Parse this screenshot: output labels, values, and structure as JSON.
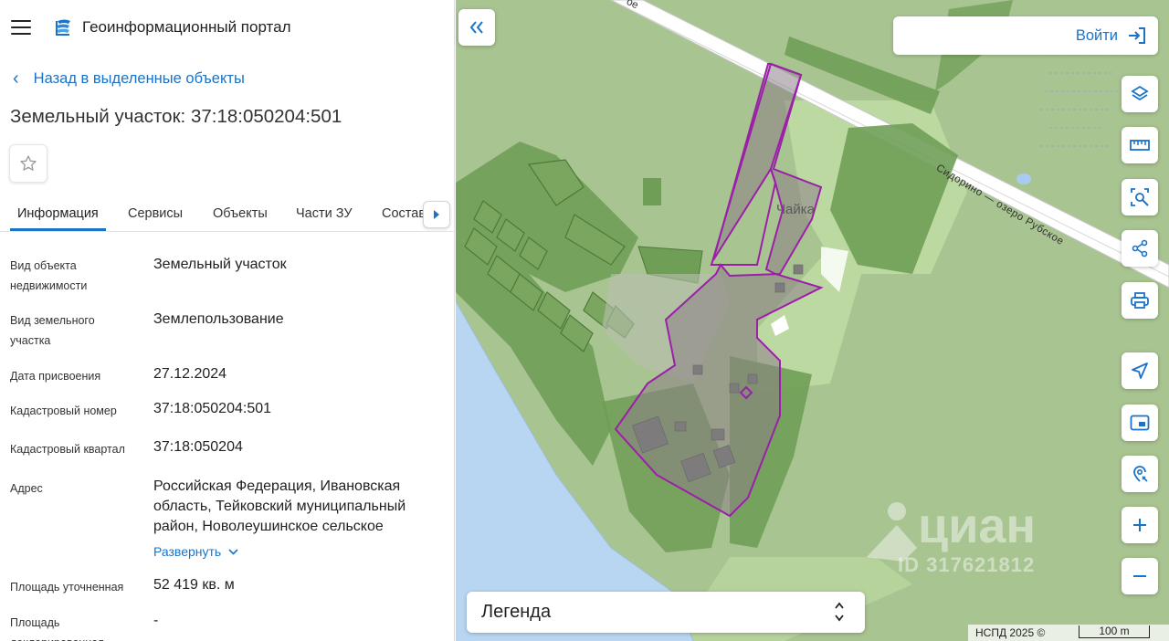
{
  "header": {
    "app_title": "Геоинформационный портал",
    "menu_icon": "menu-icon",
    "logo_icon": "portal-logo-icon"
  },
  "back_link": {
    "label": "Назад в выделенные объекты"
  },
  "object": {
    "title": "Земельный участок: 37:18:050204:501"
  },
  "tabs": [
    {
      "label": "Информация",
      "active": true
    },
    {
      "label": "Сервисы"
    },
    {
      "label": "Объекты"
    },
    {
      "label": "Части ЗУ"
    },
    {
      "label": "Состав"
    }
  ],
  "info": {
    "rows": [
      {
        "label": "Вид объекта недвижимости",
        "value": "Земельный участок"
      },
      {
        "label": "Вид земельного участка",
        "value": "Землепользование"
      },
      {
        "label": "Дата присвоения",
        "value": "27.12.2024"
      },
      {
        "label": "Кадастровый номер",
        "value": "37:18:050204:501"
      },
      {
        "label": "Кадастровый квартал",
        "value": "37:18:050204"
      },
      {
        "label": "Адрес",
        "value": "Российская Федерация, Ивановская область, Тейковский муниципальный район, Новолеушинское сельское"
      },
      {
        "label": "Площадь уточненная",
        "value": "52 419 кв. м"
      },
      {
        "label": "Площадь декларированная",
        "value": "-"
      }
    ],
    "expand_label": "Развернуть"
  },
  "map": {
    "login_label": "Войти",
    "legend_label": "Легенда",
    "attribution": "НСПД 2025 ©",
    "scale_label": "100 m",
    "place_label": "Чайка",
    "road_label": "Сидорино — озеро Рубское",
    "road_label_top": "ое",
    "watermark_name": "циан",
    "watermark_id": "ID 317621812",
    "tools": [
      "layers-icon",
      "ruler-icon",
      "area-select-icon",
      "share-icon",
      "print-icon",
      "navigate-icon",
      "minimap-icon",
      "geolocation-icon",
      "zoom-in-icon",
      "zoom-out-icon"
    ]
  },
  "colors": {
    "accent": "#1a73c8",
    "parcel_outline": "#9b1fa8",
    "forest": "#6e9d55",
    "water": "#b8d6f2"
  }
}
